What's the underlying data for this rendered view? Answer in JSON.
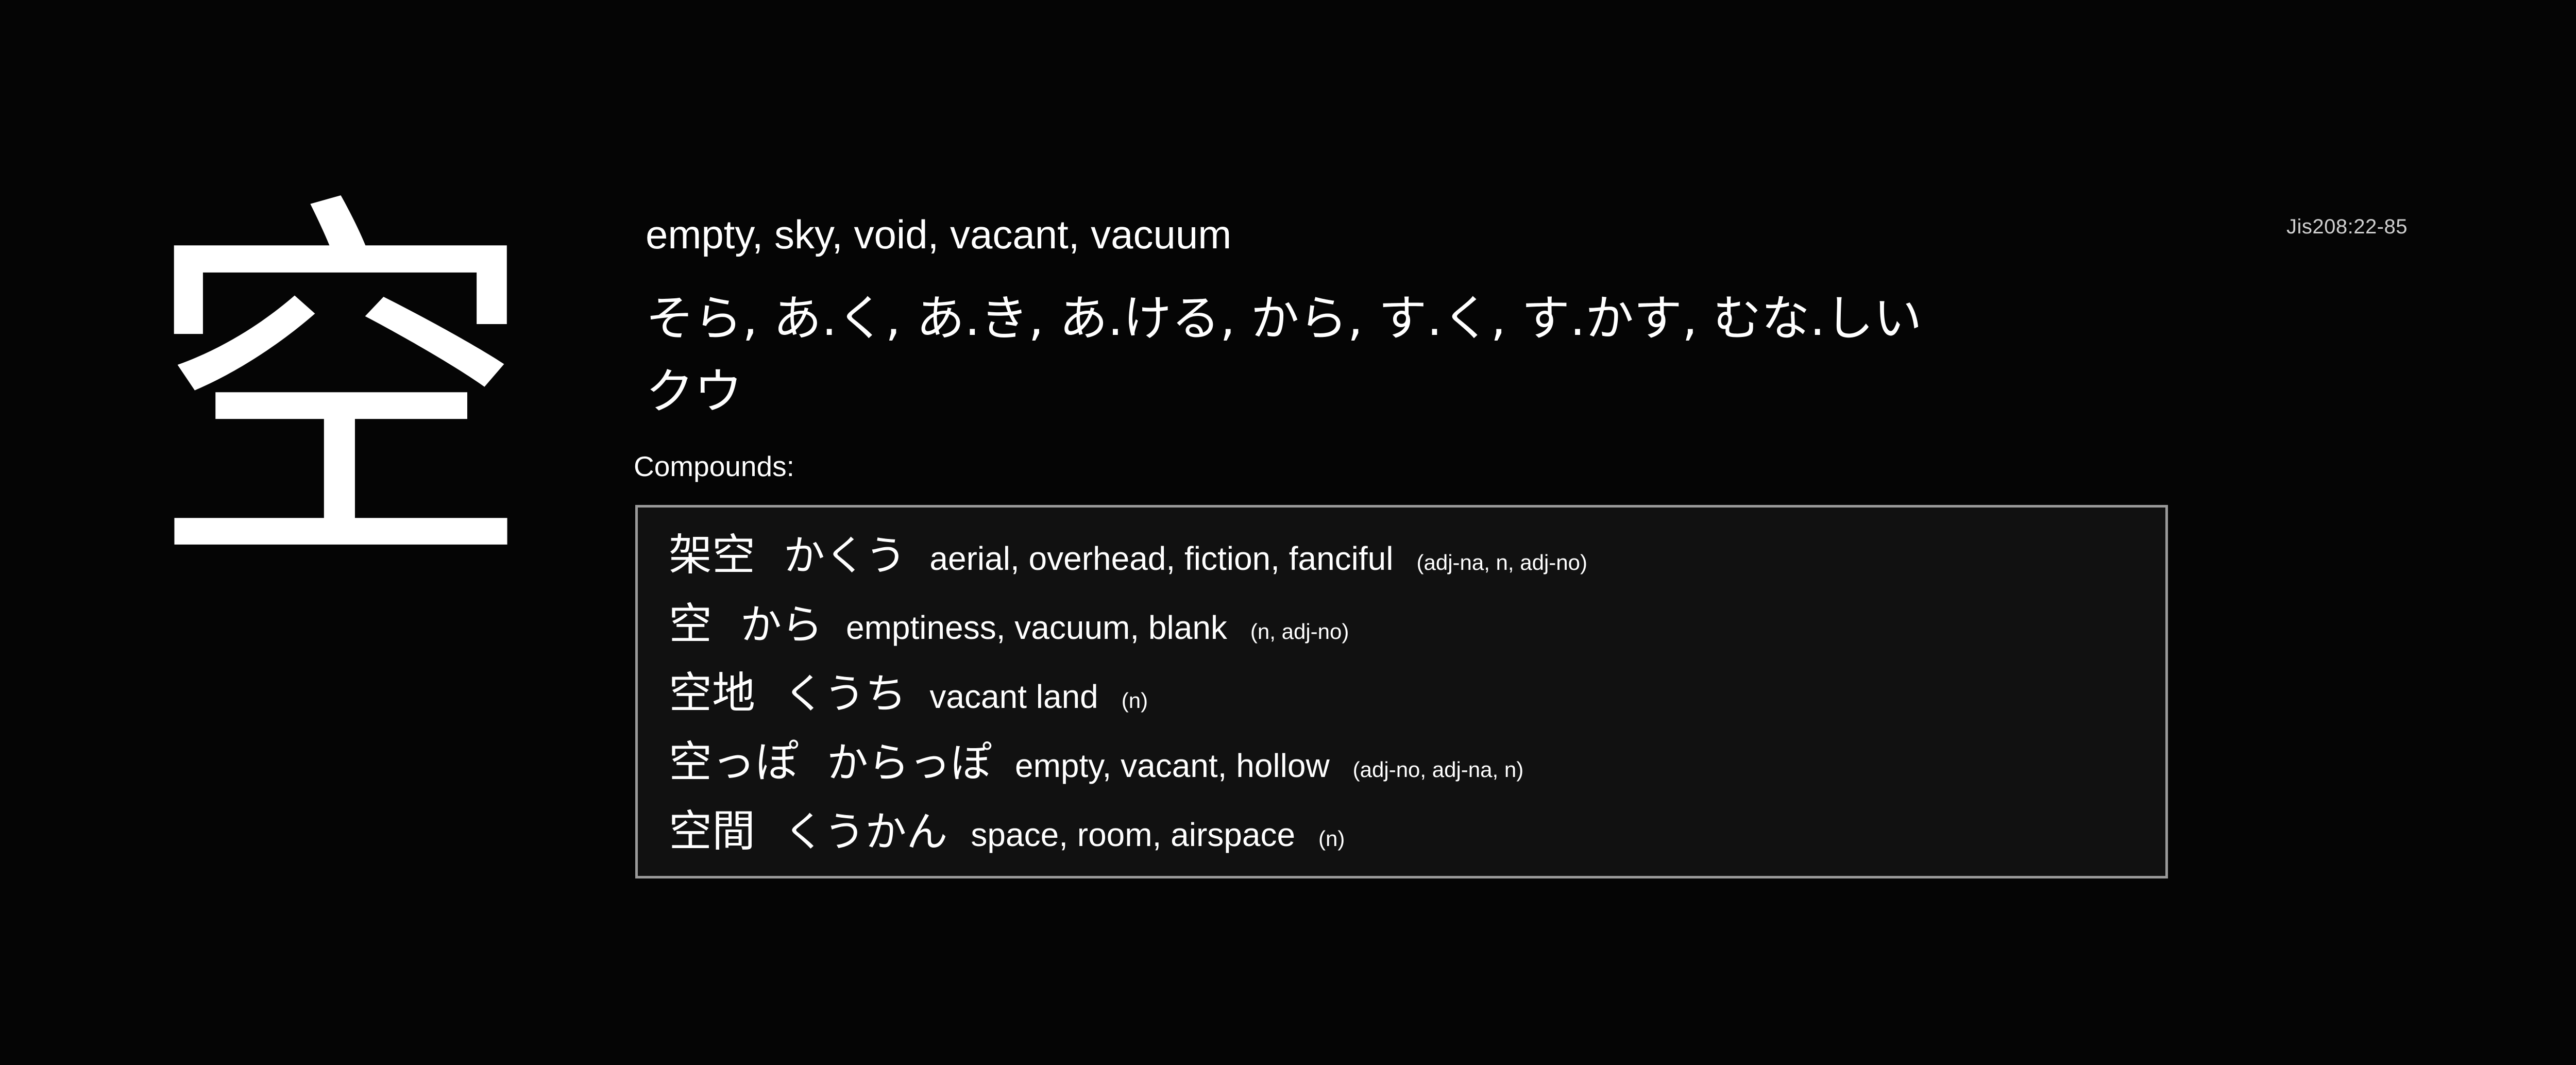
{
  "kanji": "空",
  "jis_code": "Jis208:22-85",
  "meanings": "empty, sky, void, vacant, vacuum",
  "readings": {
    "kun": "そら, あ.く, あ.き, あ.ける, から, す.く, す.かす, むな.しい",
    "on": "クウ"
  },
  "compounds_label": "Compounds:",
  "compounds": [
    {
      "word": "架空",
      "reading": "かくう",
      "meaning": "aerial, overhead, fiction, fanciful",
      "pos": "(adj-na, n, adj-no)"
    },
    {
      "word": "空",
      "reading": "から",
      "meaning": "emptiness, vacuum, blank",
      "pos": "(n, adj-no)"
    },
    {
      "word": "空地",
      "reading": "くうち",
      "meaning": "vacant land",
      "pos": "(n)"
    },
    {
      "word": "空っぽ",
      "reading": "からっぽ",
      "meaning": "empty, vacant, hollow",
      "pos": "(adj-no, adj-na, n)"
    },
    {
      "word": "空間",
      "reading": "くうかん",
      "meaning": "space, room, airspace",
      "pos": "(n)"
    }
  ]
}
